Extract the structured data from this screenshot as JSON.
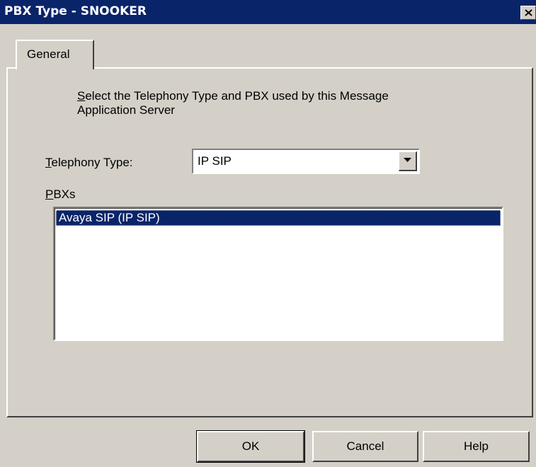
{
  "window": {
    "title": "PBX Type - SNOOKER"
  },
  "tabs": [
    {
      "label": "General",
      "active": true
    }
  ],
  "general": {
    "instruction_first_letter": "S",
    "instruction_rest_line1": "elect the Telephony Type and PBX used by this Message",
    "instruction_line2": "Application Server",
    "telephony_label_first": "T",
    "telephony_label_rest": "elephony Type:",
    "telephony_value": "IP SIP",
    "pbxs_label_first": "P",
    "pbxs_label_rest": "BXs",
    "pbx_items": [
      {
        "label": "Avaya SIP (IP SIP)",
        "selected": true
      }
    ]
  },
  "buttons": {
    "ok": "OK",
    "cancel": "Cancel",
    "help": "Help"
  },
  "colors": {
    "titlebar": "#0a246a",
    "face": "#d4d0c8",
    "selection": "#0a246a"
  },
  "icons": {
    "close": "close-x-icon",
    "dropdown": "chevron-down-icon"
  }
}
